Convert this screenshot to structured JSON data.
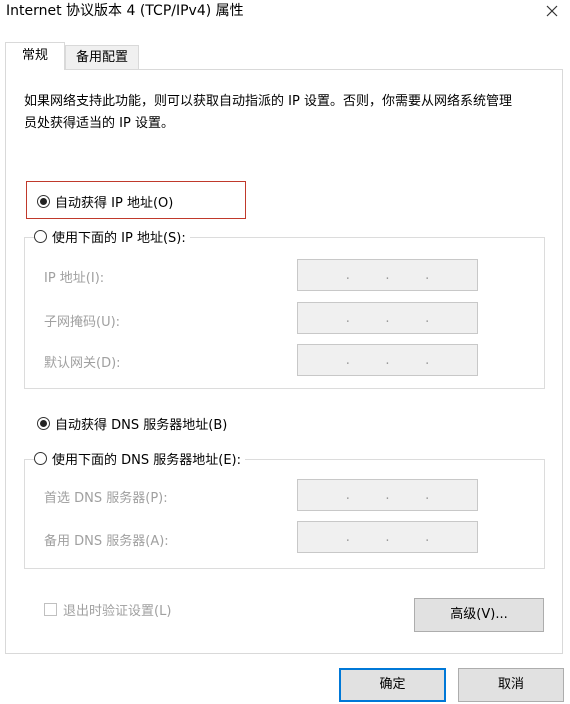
{
  "window": {
    "title": "Internet 协议版本 4 (TCP/IPv4) 属性",
    "close_icon": "close-icon"
  },
  "tabs": [
    {
      "label": "常规",
      "active": true
    },
    {
      "label": "备用配置",
      "active": false
    }
  ],
  "description": "如果网络支持此功能，则可以获取自动指派的 IP 设置。否则，你需要从网络系统管理员处获得适当的 IP 设置。",
  "ip": {
    "auto_label": "自动获得 IP 地址(O)",
    "auto_selected": true,
    "manual_label": "使用下面的 IP 地址(S):",
    "manual_selected": false,
    "fields": [
      {
        "label": "IP 地址(I):",
        "value": ". . ."
      },
      {
        "label": "子网掩码(U):",
        "value": ". . ."
      },
      {
        "label": "默认网关(D):",
        "value": ". . ."
      }
    ]
  },
  "dns": {
    "auto_label": "自动获得 DNS 服务器地址(B)",
    "auto_selected": true,
    "manual_label": "使用下面的 DNS 服务器地址(E):",
    "manual_selected": false,
    "fields": [
      {
        "label": "首选 DNS 服务器(P):",
        "value": ". . ."
      },
      {
        "label": "备用 DNS 服务器(A):",
        "value": ". . ."
      }
    ]
  },
  "validate_label": "退出时验证设置(L)",
  "validate_checked": false,
  "advanced_label": "高级(V)...",
  "ok_label": "确定",
  "cancel_label": "取消",
  "colors": {
    "highlight_border": "#c0392b",
    "default_button_border": "#0078d7",
    "disabled_text": "#a0a0a0"
  }
}
